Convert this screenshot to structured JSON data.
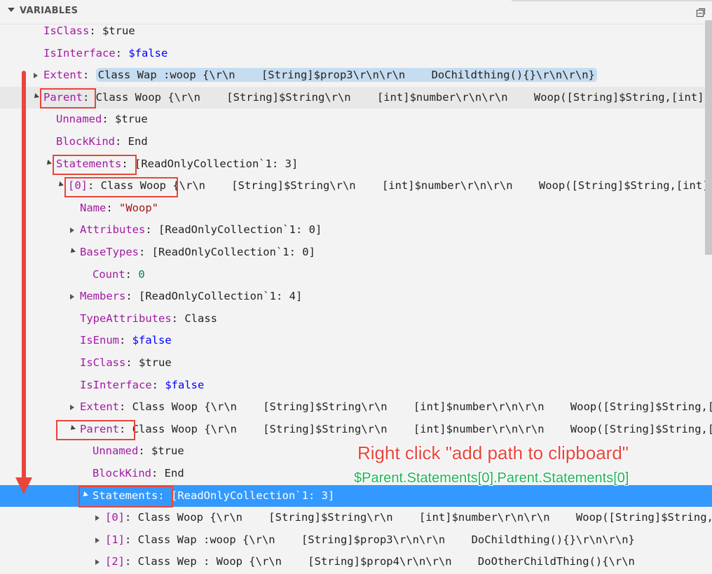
{
  "header": {
    "title": "VARIABLES"
  },
  "rows": [
    {
      "indent": 62,
      "twist": "none",
      "key": "IsClass",
      "sep": ": ",
      "value": "$true",
      "vtype": "plain"
    },
    {
      "indent": 62,
      "twist": "none",
      "key": "IsInterface",
      "sep": ": ",
      "value": "$false",
      "vtype": "bool"
    },
    {
      "indent": 62,
      "twist": "collapsed",
      "key": "Extent",
      "sep": ": ",
      "value": "Class Wap :woop {\\r\\n    [String]$prop3\\r\\n\\r\\n    DoChildthing(){}\\r\\n\\r\\n}",
      "vtype": "plain",
      "boxed": true
    },
    {
      "indent": 62,
      "twist": "expanded",
      "key": "Parent",
      "sep": ": ",
      "value": "Class Woop {\\r\\n    [String]$String\\r\\n    [int]$number\\r\\n\\r\\n    Woop([String]$String,[int]$number){\\r\\n",
      "vtype": "plain",
      "hl": true
    },
    {
      "indent": 80,
      "twist": "none",
      "key": "Unnamed",
      "sep": ": ",
      "value": "$true",
      "vtype": "plain"
    },
    {
      "indent": 80,
      "twist": "none",
      "key": "BlockKind",
      "sep": ": ",
      "value": "End",
      "vtype": "plain"
    },
    {
      "indent": 80,
      "twist": "expanded",
      "key": "Statements",
      "sep": ": ",
      "value": "[ReadOnlyCollection`1: 3]",
      "vtype": "plain"
    },
    {
      "indent": 97,
      "twist": "expanded",
      "key": "[0]",
      "sep": ": ",
      "value": "Class Woop {\\r\\n    [String]$String\\r\\n    [int]$number\\r\\n\\r\\n    Woop([String]$String,[int]$number){\\r\\n",
      "vtype": "plain"
    },
    {
      "indent": 114,
      "twist": "none",
      "key": "Name",
      "sep": ": ",
      "value": "\"Woop\"",
      "vtype": "str"
    },
    {
      "indent": 114,
      "twist": "collapsed",
      "key": "Attributes",
      "sep": ": ",
      "value": "[ReadOnlyCollection`1: 0]",
      "vtype": "plain"
    },
    {
      "indent": 114,
      "twist": "expanded",
      "key": "BaseTypes",
      "sep": ": ",
      "value": "[ReadOnlyCollection`1: 0]",
      "vtype": "plain"
    },
    {
      "indent": 132,
      "twist": "none",
      "key": "Count",
      "sep": ": ",
      "value": "0",
      "vtype": "num"
    },
    {
      "indent": 114,
      "twist": "collapsed",
      "key": "Members",
      "sep": ": ",
      "value": "[ReadOnlyCollection`1: 4]",
      "vtype": "plain"
    },
    {
      "indent": 114,
      "twist": "none",
      "key": "TypeAttributes",
      "sep": ": ",
      "value": "Class",
      "vtype": "plain"
    },
    {
      "indent": 114,
      "twist": "none",
      "key": "IsEnum",
      "sep": ": ",
      "value": "$false",
      "vtype": "bool"
    },
    {
      "indent": 114,
      "twist": "none",
      "key": "IsClass",
      "sep": ": ",
      "value": "$true",
      "vtype": "plain"
    },
    {
      "indent": 114,
      "twist": "none",
      "key": "IsInterface",
      "sep": ": ",
      "value": "$false",
      "vtype": "bool"
    },
    {
      "indent": 114,
      "twist": "collapsed",
      "key": "Extent",
      "sep": ": ",
      "value": "Class Woop {\\r\\n    [String]$String\\r\\n    [int]$number\\r\\n\\r\\n    Woop([String]$String,[int]$number){\\r\\n",
      "vtype": "plain"
    },
    {
      "indent": 114,
      "twist": "expanded",
      "key": "Parent",
      "sep": ": ",
      "value": "Class Woop {\\r\\n    [String]$String\\r\\n    [int]$number\\r\\n\\r\\n    Woop([String]$String,[int]$number){\\r\\n",
      "vtype": "plain"
    },
    {
      "indent": 132,
      "twist": "none",
      "key": "Unnamed",
      "sep": ": ",
      "value": "$true",
      "vtype": "plain"
    },
    {
      "indent": 132,
      "twist": "none",
      "key": "BlockKind",
      "sep": ": ",
      "value": "End",
      "vtype": "plain"
    },
    {
      "indent": 132,
      "twist": "expanded",
      "key": "Statements",
      "sep": ": ",
      "value": "[ReadOnlyCollection`1: 3]",
      "vtype": "plain",
      "selected": true
    },
    {
      "indent": 150,
      "twist": "collapsed",
      "key": "[0]",
      "sep": ": ",
      "value": "Class Woop {\\r\\n    [String]$String\\r\\n    [int]$number\\r\\n\\r\\n    Woop([String]$String,[int]$number){\\r\\n",
      "vtype": "plain"
    },
    {
      "indent": 150,
      "twist": "collapsed",
      "key": "[1]",
      "sep": ": ",
      "value": "Class Wap :woop {\\r\\n    [String]$prop3\\r\\n\\r\\n    DoChildthing(){}\\r\\n\\r\\n}",
      "vtype": "plain"
    },
    {
      "indent": 150,
      "twist": "collapsed",
      "key": "[2]",
      "sep": ": ",
      "value": "Class Wep : Woop {\\r\\n    [String]$prop4\\r\\n\\r\\n    DoOtherChildThing(){\\r\\n   ",
      "vtype": "plain"
    }
  ],
  "annotations": {
    "instruction": "Right click \"add path to clipboard\"",
    "path": "$Parent.Statements[0].Parent.Statements[0]"
  }
}
